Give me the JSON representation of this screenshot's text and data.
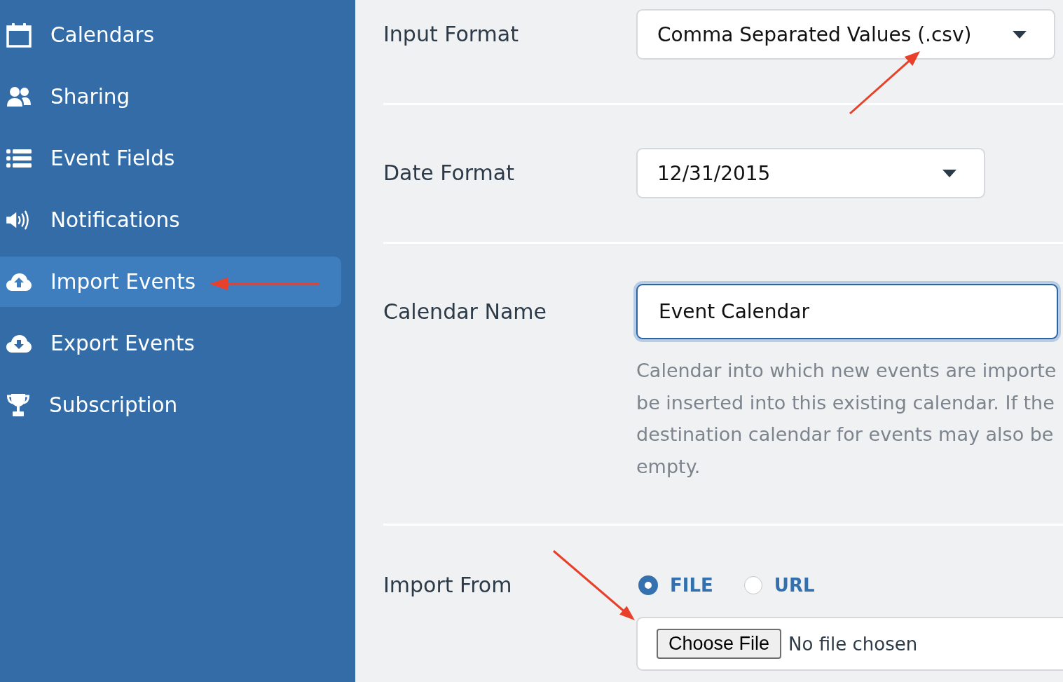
{
  "sidebar": {
    "items": [
      {
        "label": "Calendars",
        "selected": false,
        "pointer_arrow": false
      },
      {
        "label": "Sharing",
        "selected": false,
        "pointer_arrow": false
      },
      {
        "label": "Event Fields",
        "selected": false,
        "pointer_arrow": false
      },
      {
        "label": "Notifications",
        "selected": false,
        "pointer_arrow": false
      },
      {
        "label": "Import Events",
        "selected": true,
        "pointer_arrow": true
      },
      {
        "label": "Export Events",
        "selected": false,
        "pointer_arrow": false
      },
      {
        "label": "Subscription",
        "selected": false,
        "pointer_arrow": false
      }
    ]
  },
  "form": {
    "rows": [
      {
        "kind": "select",
        "label": "Input Format",
        "value": "Comma Separated Values (.csv)",
        "pointer_arrow": true
      },
      {
        "kind": "select",
        "label": "Date Format",
        "value": "12/31/2015",
        "pointer_arrow": false
      },
      {
        "kind": "text",
        "label": "Calendar Name",
        "value": "Event Calendar",
        "focused": true,
        "help_lines": [
          "Calendar into which new events are importe",
          "be inserted into this existing calendar. If the",
          "destination calendar for events may also be",
          "empty."
        ]
      },
      {
        "kind": "source",
        "label": "Import From",
        "options": [
          {
            "label": "FILE",
            "selected": true
          },
          {
            "label": "URL",
            "selected": false
          }
        ],
        "file_picker": {
          "button": "Choose File",
          "status": "No file chosen",
          "pointer_arrow": true
        }
      }
    ]
  }
}
